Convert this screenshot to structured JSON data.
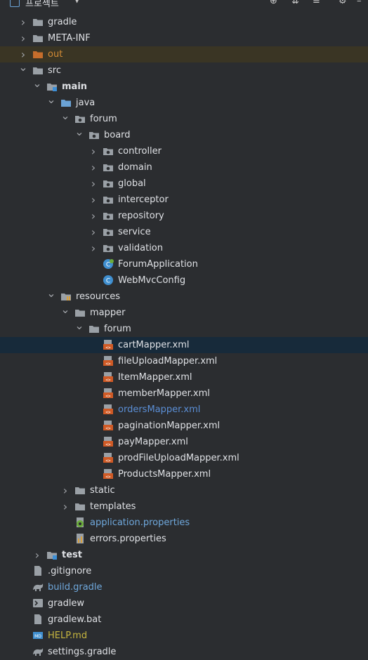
{
  "header": {
    "title": "프로젝트",
    "icons": [
      "target-icon",
      "collapse-all-icon",
      "expand-icon",
      "gear-icon"
    ]
  },
  "tree": [
    {
      "label": "gradle",
      "icon": "folder",
      "depth": 0,
      "arrow": "collapsed"
    },
    {
      "label": "META-INF",
      "icon": "folder",
      "depth": 0,
      "arrow": "collapsed"
    },
    {
      "label": "out",
      "icon": "folder-excluded",
      "depth": 0,
      "arrow": "collapsed",
      "color": "orange",
      "state": "highlight"
    },
    {
      "label": "src",
      "icon": "folder",
      "depth": 0,
      "arrow": "expanded"
    },
    {
      "label": "main",
      "icon": "folder-module",
      "depth": 1,
      "arrow": "expanded",
      "bold": true
    },
    {
      "label": "java",
      "icon": "folder-source",
      "depth": 2,
      "arrow": "expanded"
    },
    {
      "label": "forum",
      "icon": "package",
      "depth": 3,
      "arrow": "expanded"
    },
    {
      "label": "board",
      "icon": "package",
      "depth": 4,
      "arrow": "expanded"
    },
    {
      "label": "controller",
      "icon": "package",
      "depth": 5,
      "arrow": "collapsed"
    },
    {
      "label": "domain",
      "icon": "package",
      "depth": 5,
      "arrow": "collapsed"
    },
    {
      "label": "global",
      "icon": "package",
      "depth": 5,
      "arrow": "collapsed"
    },
    {
      "label": "interceptor",
      "icon": "package",
      "depth": 5,
      "arrow": "collapsed"
    },
    {
      "label": "repository",
      "icon": "package",
      "depth": 5,
      "arrow": "collapsed"
    },
    {
      "label": "service",
      "icon": "package",
      "depth": 5,
      "arrow": "collapsed"
    },
    {
      "label": "validation",
      "icon": "package",
      "depth": 5,
      "arrow": "collapsed"
    },
    {
      "label": "ForumApplication",
      "icon": "spring-class",
      "depth": 5,
      "arrow": "none"
    },
    {
      "label": "WebMvcConfig",
      "icon": "class",
      "depth": 5,
      "arrow": "none"
    },
    {
      "label": "resources",
      "icon": "folder-resources",
      "depth": 2,
      "arrow": "expanded"
    },
    {
      "label": "mapper",
      "icon": "folder",
      "depth": 3,
      "arrow": "expanded"
    },
    {
      "label": "forum",
      "icon": "folder",
      "depth": 4,
      "arrow": "expanded"
    },
    {
      "label": "cartMapper.xml",
      "icon": "xml",
      "depth": 5,
      "arrow": "none",
      "state": "selected"
    },
    {
      "label": "fileUploadMapper.xml",
      "icon": "xml",
      "depth": 5,
      "arrow": "none"
    },
    {
      "label": "ItemMapper.xml",
      "icon": "xml",
      "depth": 5,
      "arrow": "none"
    },
    {
      "label": "memberMapper.xml",
      "icon": "xml",
      "depth": 5,
      "arrow": "none"
    },
    {
      "label": "ordersMapper.xml",
      "icon": "xml",
      "depth": 5,
      "arrow": "none",
      "color": "mapperblue"
    },
    {
      "label": "paginationMapper.xml",
      "icon": "xml",
      "depth": 5,
      "arrow": "none"
    },
    {
      "label": "payMapper.xml",
      "icon": "xml",
      "depth": 5,
      "arrow": "none"
    },
    {
      "label": "prodFileUploadMapper.xml",
      "icon": "xml",
      "depth": 5,
      "arrow": "none"
    },
    {
      "label": "ProductsMapper.xml",
      "icon": "xml",
      "depth": 5,
      "arrow": "none"
    },
    {
      "label": "static",
      "icon": "folder",
      "depth": 3,
      "arrow": "collapsed"
    },
    {
      "label": "templates",
      "icon": "folder",
      "depth": 3,
      "arrow": "collapsed"
    },
    {
      "label": "application.properties",
      "icon": "spring-properties",
      "depth": 3,
      "arrow": "none",
      "color": "blue"
    },
    {
      "label": "errors.properties",
      "icon": "properties",
      "depth": 3,
      "arrow": "none"
    },
    {
      "label": "test",
      "icon": "folder-module",
      "depth": 1,
      "arrow": "collapsed",
      "bold": true
    },
    {
      "label": ".gitignore",
      "icon": "file",
      "depth": 0,
      "arrow": "none"
    },
    {
      "label": "build.gradle",
      "icon": "gradle",
      "depth": 0,
      "arrow": "none",
      "color": "blue"
    },
    {
      "label": "gradlew",
      "icon": "shell",
      "depth": 0,
      "arrow": "none"
    },
    {
      "label": "gradlew.bat",
      "icon": "file",
      "depth": 0,
      "arrow": "none"
    },
    {
      "label": "HELP.md",
      "icon": "markdown",
      "depth": 0,
      "arrow": "none",
      "color": "yellow"
    },
    {
      "label": "settings.gradle",
      "icon": "gradle",
      "depth": 0,
      "arrow": "none"
    }
  ]
}
